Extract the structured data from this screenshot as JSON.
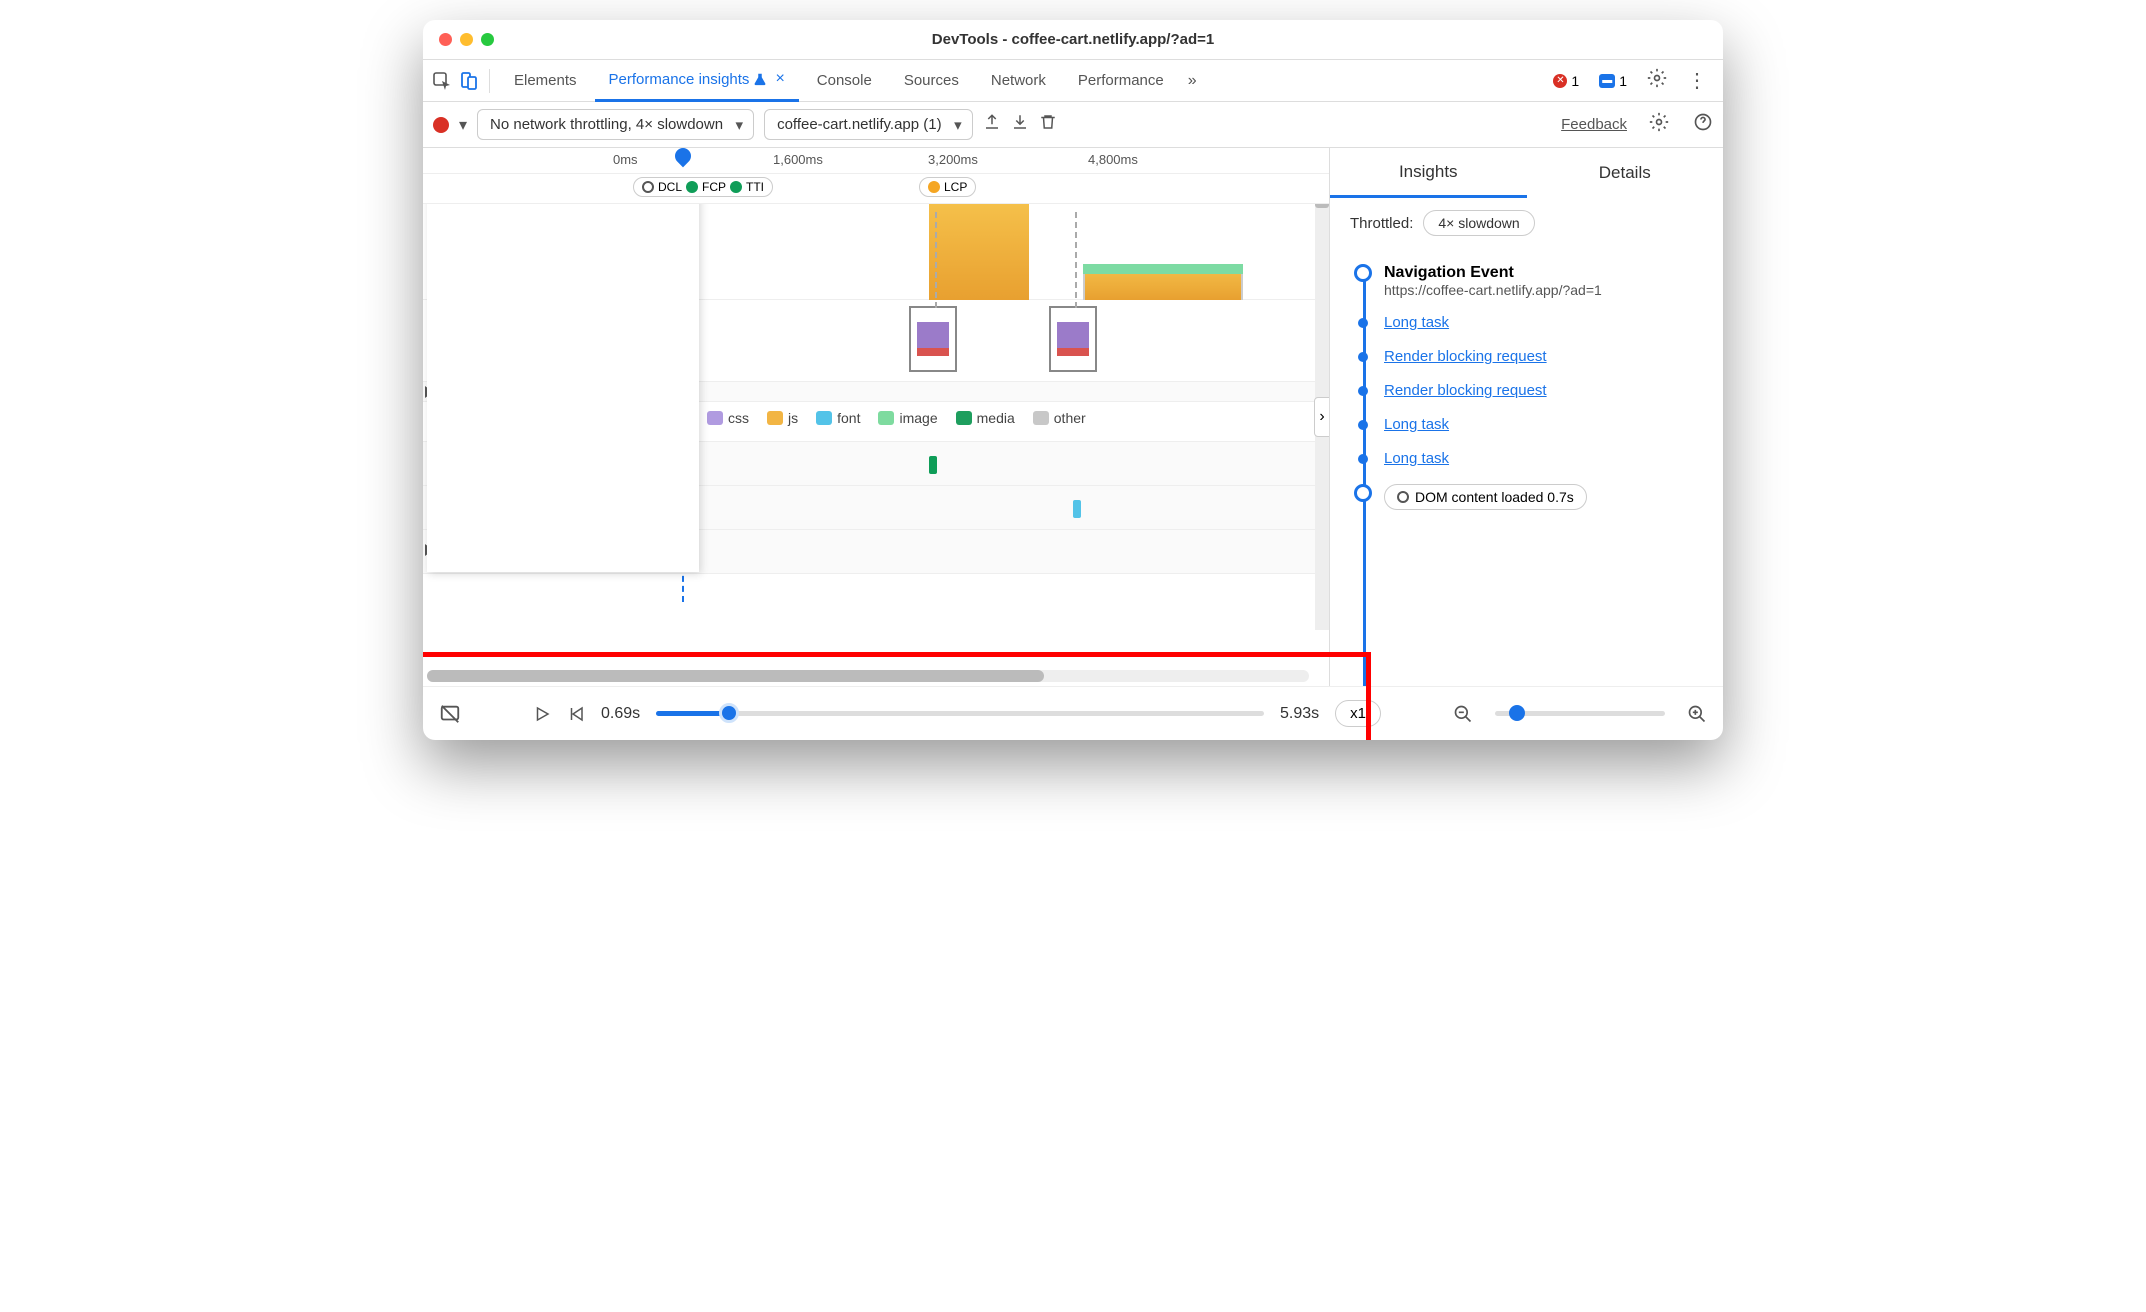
{
  "window": {
    "title": "DevTools - coffee-cart.netlify.app/?ad=1"
  },
  "tabs": {
    "elements": "Elements",
    "perfInsights": "Performance insights",
    "console": "Console",
    "sources": "Sources",
    "network": "Network",
    "performance": "Performance"
  },
  "badges": {
    "errors": "1",
    "messages": "1"
  },
  "toolbar": {
    "throttling": "No network throttling, 4× slowdown",
    "origin": "coffee-cart.netlify.app (1)",
    "feedback": "Feedback"
  },
  "ruler": {
    "ticks": [
      "0ms",
      "1,600ms",
      "3,200ms",
      "4,800ms"
    ]
  },
  "markers": {
    "dcl": "DCL",
    "fcp": "FCP",
    "tti": "TTI",
    "lcp": "LCP"
  },
  "legend": {
    "css": "css",
    "js": "js",
    "font": "font",
    "image": "image",
    "media": "media",
    "other": "other"
  },
  "side": {
    "tabs": {
      "insights": "Insights",
      "details": "Details"
    },
    "throttled_label": "Throttled:",
    "throttled_value": "4× slowdown",
    "nav_title": "Navigation Event",
    "nav_url": "https://coffee-cart.netlify.app/?ad=1",
    "items": {
      "i1": "Long task",
      "i2": "Render blocking request",
      "i3": "Render blocking request",
      "i4": "Long task",
      "i5": "Long task",
      "i6": "DOM content loaded 0.7s"
    }
  },
  "playback": {
    "start": "0.69s",
    "end": "5.93s",
    "speed": "x1"
  }
}
